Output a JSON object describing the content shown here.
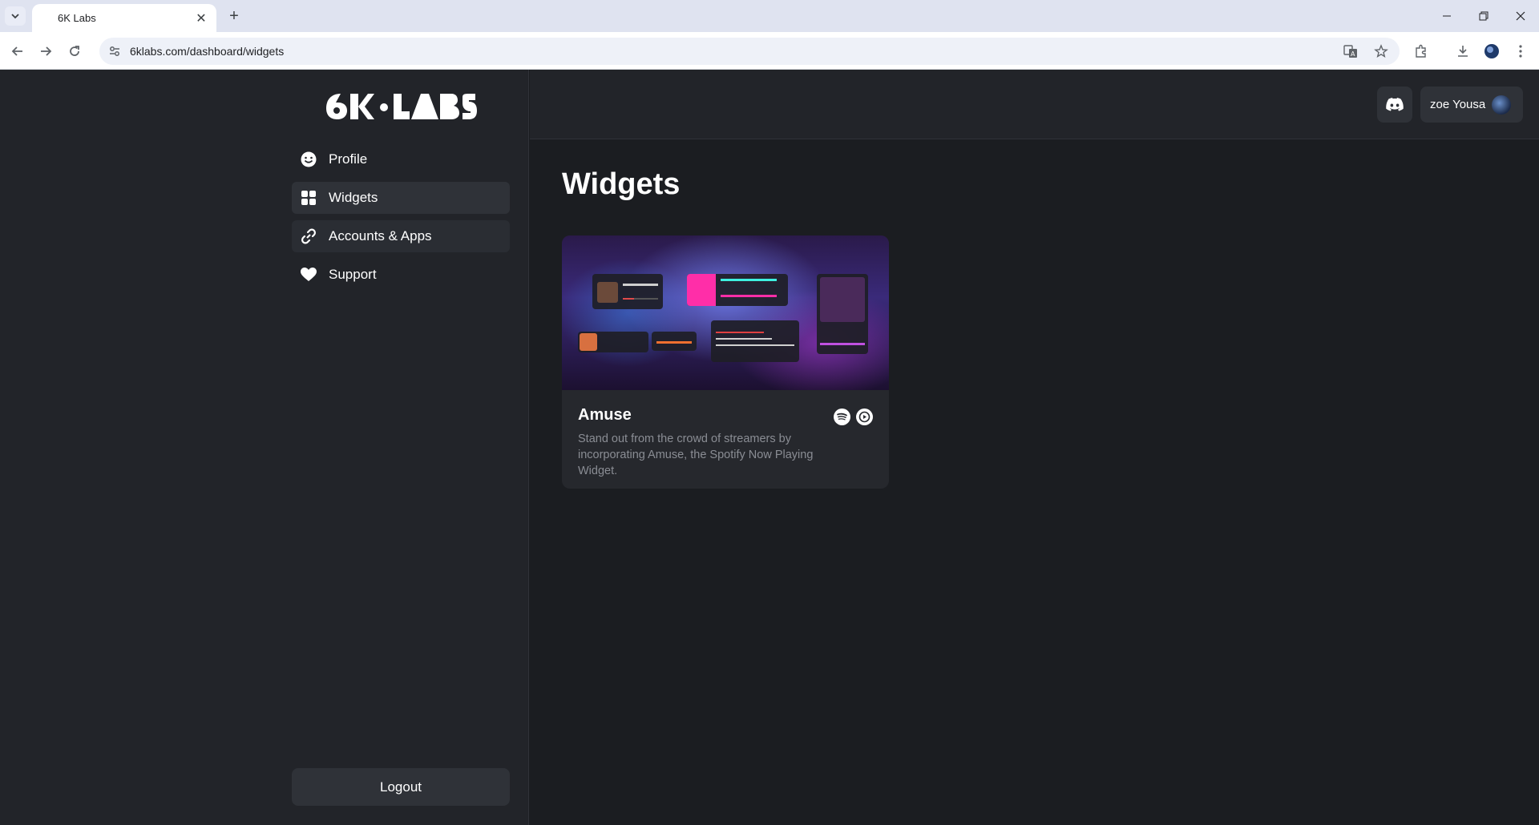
{
  "browser": {
    "tab_title": "6K Labs",
    "url": "6klabs.com/dashboard/widgets"
  },
  "sidebar": {
    "logo_text": "6K·LABS",
    "items": [
      {
        "label": "Profile",
        "icon": "smile-icon"
      },
      {
        "label": "Widgets",
        "icon": "grid-icon"
      },
      {
        "label": "Accounts & Apps",
        "icon": "link-icon"
      },
      {
        "label": "Support",
        "icon": "heart-icon"
      }
    ],
    "logout_label": "Logout"
  },
  "header": {
    "user_name": "zoe Yousa"
  },
  "main": {
    "title": "Widgets",
    "cards": [
      {
        "title": "Amuse",
        "description": "Stand out from the crowd of streamers by incorporating Amuse, the Spotify Now Playing Widget.",
        "icons": [
          "spotify-icon",
          "music-disc-icon"
        ]
      }
    ]
  },
  "colors": {
    "sidebar_bg": "#222429",
    "main_bg": "#1b1d21",
    "active_item_bg": "#2f3238",
    "card_bg": "#26282d"
  }
}
